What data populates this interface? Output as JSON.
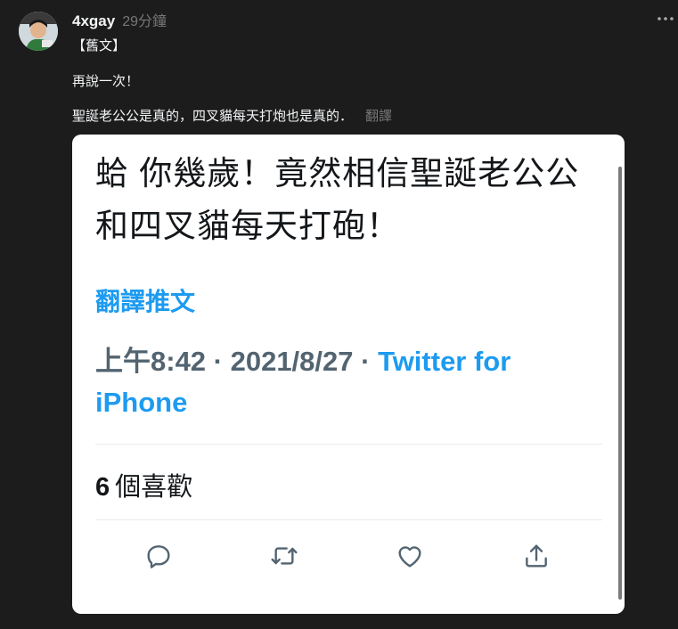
{
  "post": {
    "username": "4xgay",
    "time": "29分鐘",
    "line1": "【舊文】",
    "line2": "再說一次！",
    "line3": "聖誕老公公是真的，四叉貓每天打炮也是真的．",
    "translate": "翻譯"
  },
  "tweet": {
    "text": "蛤 你幾歲！竟然相信聖誕老公公和四叉貓每天打砲！",
    "translate_label": "翻譯推文",
    "timestamp": "上午8:42 · 2021/8/27 · ",
    "source": "Twitter for iPhone",
    "likes_count": "6",
    "likes_label": "個喜歡"
  },
  "icons": {
    "more": "more-horizontal-icon",
    "reply": "reply-icon",
    "retweet": "retweet-icon",
    "like": "heart-icon",
    "share": "share-icon"
  },
  "colors": {
    "background": "#1c1c1c",
    "link": "#1d9bf0",
    "muted": "#536471"
  }
}
